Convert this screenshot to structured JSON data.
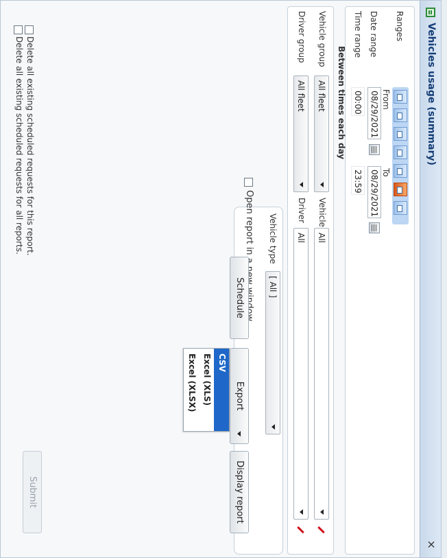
{
  "window": {
    "title": "Vehicles usage (summary)",
    "close_label": "×"
  },
  "ranges": {
    "label": "Ranges",
    "buttons": [
      "today",
      "yesterday",
      "this-week",
      "last-week",
      "this-month",
      "last-month",
      "custom"
    ]
  },
  "date_range": {
    "label": "Date range",
    "from_label": "From",
    "to_label": "To",
    "from_value": "08/29/2021",
    "to_value": "08/29/2021"
  },
  "time_range": {
    "label": "Time range",
    "from_value": "00:00",
    "to_value": "23:59",
    "between_label": "Between times each day"
  },
  "vehicle_group": {
    "label": "Vehicle group",
    "value": "All fleet"
  },
  "vehicle": {
    "label": "Vehicle",
    "value": "All"
  },
  "driver_group": {
    "label": "Driver group",
    "value": "All fleet"
  },
  "driver": {
    "label": "Driver",
    "value": "All"
  },
  "vehicle_type": {
    "label": "Vehicle type",
    "value": "[ All ]"
  },
  "open_new_window": {
    "label": "Open report in a new window"
  },
  "actions": {
    "schedule": "Schedule",
    "export": "Export",
    "display": "Display report",
    "submit": "Submit"
  },
  "export_menu": {
    "items": [
      "CSV",
      "Excel (XLS)",
      "Excel (XLSX)"
    ],
    "selected": "CSV"
  },
  "delete_options": {
    "this_report": "Delete all existing scheduled requests for this report.",
    "all_reports": "Delete all existing scheduled requests for all reports."
  }
}
